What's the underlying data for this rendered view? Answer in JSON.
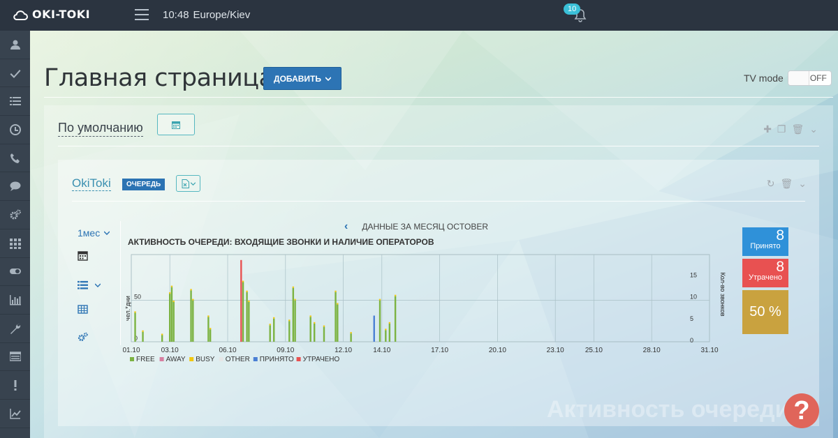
{
  "topbar": {
    "brand": "OKI-TOKI",
    "time": "10:48",
    "timezone": "Europe/Kiev",
    "notifications": "10"
  },
  "sidebar": {
    "items": [
      "user-icon",
      "check-icon",
      "list-icon",
      "clock-icon",
      "phone-icon",
      "chat-icon",
      "gears-icon",
      "grid-icon",
      "toggle-icon",
      "bar-chart-icon",
      "wrench-icon",
      "table-icon",
      "exclamation-icon",
      "line-chart-icon"
    ]
  },
  "header": {
    "title": "Главная страница",
    "add_label": "ДОБАВИТЬ",
    "tv_mode_label": "TV mode",
    "tv_mode_state": "OFF"
  },
  "dashboard": {
    "title": "По умолчанию"
  },
  "widget": {
    "title": "OkiToki",
    "badge": "ОЧЕРЕДЬ",
    "period": "1мес",
    "nav_label": "ДАННЫЕ ЗА  МЕСЯЦ  OCTOBER",
    "chart_title": "АКТИВНОСТЬ ОЧЕРЕДИ: ВХОДЯЩИЕ ЗВОНКИ И НАЛИЧИЕ ОПЕРАТОРОВ"
  },
  "stats": {
    "accepted_value": "8",
    "accepted_label": "Принято",
    "lost_value": "8",
    "lost_label": "Утрачено",
    "percent": "50 %"
  },
  "watermark": "Активность очереди",
  "chart_data": {
    "type": "bar",
    "title": "АКТИВНОСТЬ ОЧЕРЕДИ: ВХОДЯЩИЕ ЗВОНКИ И НАЛИЧИЕ ОПЕРАТОРОВ",
    "ylabel": "чел.*дни",
    "y2label": "Кол-во звонков",
    "ylim": [
      0,
      100
    ],
    "y2lim": [
      0,
      20
    ],
    "yticks": [
      "0",
      "50"
    ],
    "y2ticks": [
      "0",
      "5",
      "10",
      "15"
    ],
    "xticks": [
      "01.10",
      "03.10",
      "06.10",
      "09.10",
      "12.10",
      "14.10",
      "17.10",
      "20.10",
      "23.10",
      "25.10",
      "28.10",
      "31.10"
    ],
    "legend": [
      {
        "name": "FREE",
        "color": "#7cb342"
      },
      {
        "name": "AWAY",
        "color": "#d77fa1"
      },
      {
        "name": "BUSY",
        "color": "#f2c80f"
      },
      {
        "name": "OTHER",
        "color": "#e6e6e6"
      },
      {
        "name": "ПРИНЯТО",
        "color": "#4a7fd4"
      },
      {
        "name": "УТРАЧЕНО",
        "color": "#e85151"
      }
    ],
    "free_bars": [
      {
        "day": 1.2,
        "value": 35
      },
      {
        "day": 1.6,
        "value": 12
      },
      {
        "day": 2.6,
        "value": 8
      },
      {
        "day": 3.0,
        "value": 58
      },
      {
        "day": 3.1,
        "value": 66
      },
      {
        "day": 3.2,
        "value": 48
      },
      {
        "day": 4.1,
        "value": 62
      },
      {
        "day": 4.2,
        "value": 50
      },
      {
        "day": 5.0,
        "value": 30
      },
      {
        "day": 5.1,
        "value": 15
      },
      {
        "day": 6.8,
        "value": 72
      },
      {
        "day": 7.0,
        "value": 60
      },
      {
        "day": 7.1,
        "value": 48
      },
      {
        "day": 8.2,
        "value": 20
      },
      {
        "day": 8.4,
        "value": 28
      },
      {
        "day": 9.2,
        "value": 25
      },
      {
        "day": 9.4,
        "value": 65
      },
      {
        "day": 9.5,
        "value": 50
      },
      {
        "day": 10.3,
        "value": 30
      },
      {
        "day": 10.5,
        "value": 22
      },
      {
        "day": 11.0,
        "value": 18
      },
      {
        "day": 11.6,
        "value": 60
      },
      {
        "day": 11.7,
        "value": 45
      },
      {
        "day": 12.4,
        "value": 10
      },
      {
        "day": 13.9,
        "value": 50
      },
      {
        "day": 14.2,
        "value": 14
      },
      {
        "day": 14.4,
        "value": 22
      },
      {
        "day": 14.7,
        "value": 55
      }
    ],
    "accepted_bars": [
      {
        "day": 13.6,
        "value": 1
      }
    ],
    "lost_bars": [
      {
        "day": 6.7,
        "value": 15
      }
    ]
  }
}
